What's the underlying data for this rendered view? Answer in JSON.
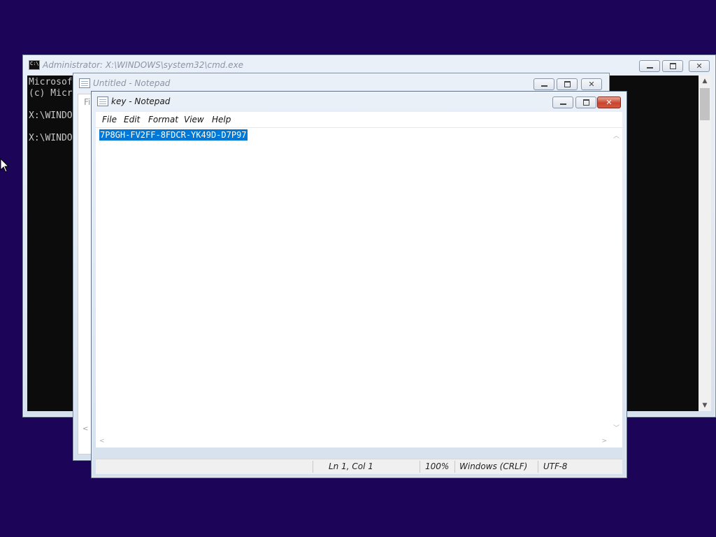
{
  "cmd": {
    "title": "Administrator: X:\\WINDOWS\\system32\\cmd.exe",
    "icon_label": "C:\\",
    "lines": [
      "Microsof",
      "(c) Micr",
      "",
      "X:\\WINDO",
      "",
      "X:\\WINDO"
    ]
  },
  "untitled": {
    "title": "Untitled - Notepad",
    "menu_stub": "Fi"
  },
  "key": {
    "title": "key - Notepad",
    "menu": [
      "File",
      "Edit",
      "Format",
      "View",
      "Help"
    ],
    "text": "7P8GH-FV2FF-8FDCR-YK49D-D7P97",
    "status": {
      "position": "Ln 1, Col 1",
      "zoom": "100%",
      "line_ending": "Windows (CRLF)",
      "encoding": "UTF-8"
    }
  },
  "icons": {
    "up": "up-arrow-icon",
    "down": "down-arrow-icon",
    "left": "left-arrow-icon",
    "right": "right-arrow-icon"
  },
  "colors": {
    "desktop": "#1c0458",
    "selection": "#0078d7",
    "close": "#c8452e"
  }
}
